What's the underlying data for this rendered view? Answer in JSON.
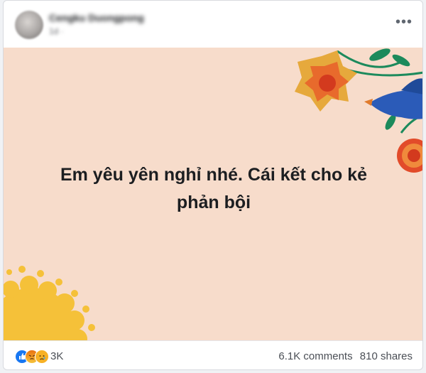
{
  "post": {
    "author_name": "Cengku Duongpong",
    "meta": "1d ·",
    "text_line1": "Em yêu yên nghỉ nhé. Cái kết cho kẻ",
    "text_line2": "phản bội",
    "background_color": "#f7dccb"
  },
  "reactions": {
    "icons": [
      "like-icon",
      "angry-icon",
      "sad-icon"
    ],
    "count": "3K"
  },
  "stats": {
    "comments": "6.1K comments",
    "shares": "810 shares"
  },
  "menu_icon": "more-horizontal-icon"
}
